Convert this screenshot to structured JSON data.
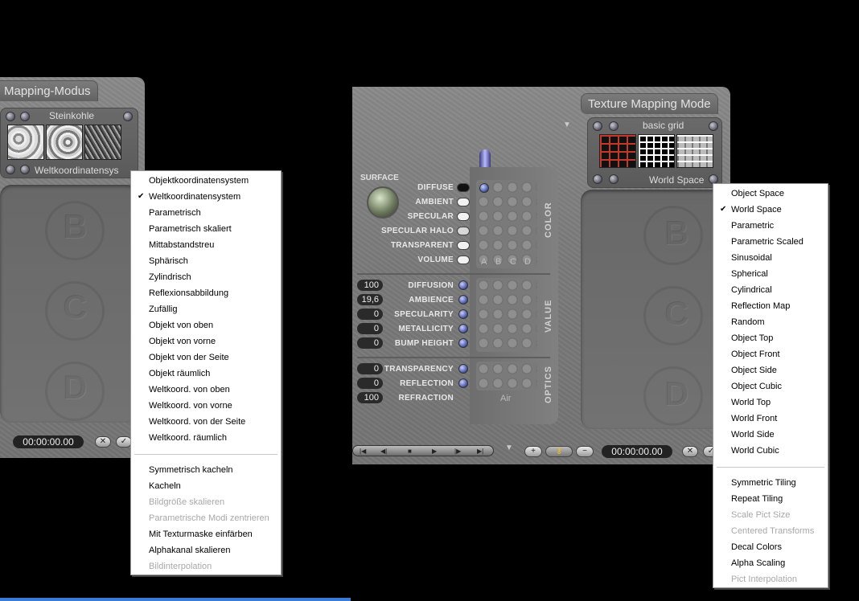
{
  "left_panel": {
    "title": "Mapping-Modus",
    "texture_name": "Steinkohle",
    "mode_label": "Weltkoordinatensys",
    "timecode": "00:00:00.00",
    "ghost_letters": [
      "B",
      "C",
      "D"
    ]
  },
  "left_menu": {
    "items": [
      {
        "label": "Objektkoordinatensystem",
        "checked": false,
        "disabled": false
      },
      {
        "label": "Weltkoordinatensystem",
        "checked": true,
        "disabled": false
      },
      {
        "label": "Parametrisch",
        "checked": false,
        "disabled": false
      },
      {
        "label": "Parametrisch skaliert",
        "checked": false,
        "disabled": false
      },
      {
        "label": "Mittabstandstreu",
        "checked": false,
        "disabled": false
      },
      {
        "label": "Sphärisch",
        "checked": false,
        "disabled": false
      },
      {
        "label": "Zylindrisch",
        "checked": false,
        "disabled": false
      },
      {
        "label": "Reflexionsabbildung",
        "checked": false,
        "disabled": false
      },
      {
        "label": "Zufällig",
        "checked": false,
        "disabled": false
      },
      {
        "label": "Objekt von oben",
        "checked": false,
        "disabled": false
      },
      {
        "label": "Objekt von vorne",
        "checked": false,
        "disabled": false
      },
      {
        "label": "Objekt von der Seite",
        "checked": false,
        "disabled": false
      },
      {
        "label": "Objekt räumlich",
        "checked": false,
        "disabled": false
      },
      {
        "label": "Weltkoord. von oben",
        "checked": false,
        "disabled": false
      },
      {
        "label": "Weltkoord. von vorne",
        "checked": false,
        "disabled": false
      },
      {
        "label": "Weltkoord. von der Seite",
        "checked": false,
        "disabled": false
      },
      {
        "label": "Weltkoord. räumlich",
        "checked": false,
        "disabled": false
      }
    ],
    "options": [
      {
        "label": "Symmetrisch kacheln",
        "disabled": false
      },
      {
        "label": "Kacheln",
        "disabled": false
      },
      {
        "label": "Bildgröße skalieren",
        "disabled": true
      },
      {
        "label": "Parametrische Modi zentrieren",
        "disabled": true
      },
      {
        "label": "Mit Texturmaske einfärben",
        "disabled": false
      },
      {
        "label": "Alphakanal skalieren",
        "disabled": false
      },
      {
        "label": "Bildinterpolation",
        "disabled": true
      }
    ]
  },
  "right_panel": {
    "title": "Texture Mapping Mode",
    "texture_name": "basic grid",
    "mode_label": "World Space",
    "timecode": "00:00:00.00",
    "ghost_letters": [
      "B",
      "C",
      "D"
    ],
    "surface": {
      "heading": "SURFACE",
      "color_rows": [
        {
          "label": "DIFFUSE",
          "swatch": "#111111"
        },
        {
          "label": "AMBIENT",
          "swatch": "#f2f2f2"
        },
        {
          "label": "SPECULAR",
          "swatch": "#f2f2f2"
        },
        {
          "label": "SPECULAR HALO",
          "swatch": "#d8d8d8"
        },
        {
          "label": "TRANSPARENT",
          "swatch": "#f2f2f2"
        },
        {
          "label": "VOLUME",
          "swatch": "#f2f2f2"
        }
      ],
      "columns": [
        "A",
        "B",
        "C",
        "D"
      ],
      "color_tab": "COLOR",
      "value_rows": [
        {
          "value": "100",
          "label": "DIFFUSION"
        },
        {
          "value": "19,6",
          "label": "AMBIENCE"
        },
        {
          "value": "0",
          "label": "SPECULARITY"
        },
        {
          "value": "0",
          "label": "METALLICITY"
        },
        {
          "value": "0",
          "label": "BUMP HEIGHT"
        }
      ],
      "value_tab": "VALUE",
      "optics_rows": [
        {
          "value": "0",
          "label": "TRANSPARENCY"
        },
        {
          "value": "0",
          "label": "REFLECTION"
        },
        {
          "value": "100",
          "label": "REFRACTION"
        }
      ],
      "refraction_preset": "Air",
      "optics_tab": "OPTICS"
    }
  },
  "right_menu": {
    "items": [
      {
        "label": "Object Space",
        "checked": false,
        "disabled": false
      },
      {
        "label": "World Space",
        "checked": true,
        "disabled": false
      },
      {
        "label": "Parametric",
        "checked": false,
        "disabled": false
      },
      {
        "label": "Parametric Scaled",
        "checked": false,
        "disabled": false
      },
      {
        "label": "Sinusoidal",
        "checked": false,
        "disabled": false
      },
      {
        "label": "Spherical",
        "checked": false,
        "disabled": false
      },
      {
        "label": "Cylindrical",
        "checked": false,
        "disabled": false
      },
      {
        "label": "Reflection Map",
        "checked": false,
        "disabled": false
      },
      {
        "label": "Random",
        "checked": false,
        "disabled": false
      },
      {
        "label": "Object Top",
        "checked": false,
        "disabled": false
      },
      {
        "label": "Object Front",
        "checked": false,
        "disabled": false
      },
      {
        "label": "Object Side",
        "checked": false,
        "disabled": false
      },
      {
        "label": "Object Cubic",
        "checked": false,
        "disabled": false
      },
      {
        "label": "World Top",
        "checked": false,
        "disabled": false
      },
      {
        "label": "World Front",
        "checked": false,
        "disabled": false
      },
      {
        "label": "World Side",
        "checked": false,
        "disabled": false
      },
      {
        "label": "World Cubic",
        "checked": false,
        "disabled": false
      }
    ],
    "options": [
      {
        "label": "Symmetric Tiling",
        "disabled": false
      },
      {
        "label": "Repeat Tiling",
        "disabled": false
      },
      {
        "label": "Scale Pict Size",
        "disabled": true
      },
      {
        "label": "Centered Transforms",
        "disabled": true
      },
      {
        "label": "Decal Colors",
        "disabled": false
      },
      {
        "label": "Alpha Scaling",
        "disabled": false
      },
      {
        "label": "Pict Interpolation",
        "disabled": true
      }
    ]
  },
  "colors": {
    "panel": "#7b7b7b",
    "menu_bg": "#ffffff",
    "disabled_text": "#a8a8a8",
    "knob_blue": "#4a5aa8"
  }
}
